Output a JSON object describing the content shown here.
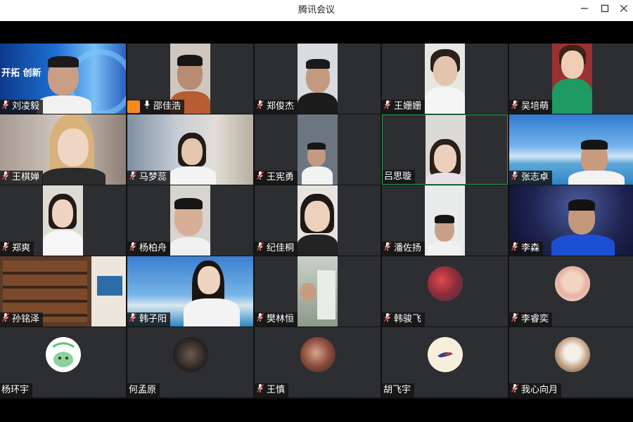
{
  "window": {
    "title": "腾讯会议",
    "min_icon": "minimize-icon",
    "max_icon": "maximize-icon",
    "close_icon": "close-icon"
  },
  "banner_text": "开拓 创新",
  "participants": [
    {
      "name": "刘凌毅",
      "mic": "muted"
    },
    {
      "name": "邵佳浩",
      "mic": "on"
    },
    {
      "name": "郑俊杰",
      "mic": "muted"
    },
    {
      "name": "王姗姗",
      "mic": "muted"
    },
    {
      "name": "吴培萌",
      "mic": "muted"
    },
    {
      "name": "王棋婵",
      "mic": "muted"
    },
    {
      "name": "马梦蕊",
      "mic": "muted"
    },
    {
      "name": "王宪勇",
      "mic": "muted"
    },
    {
      "name": "吕思璇",
      "mic": "none"
    },
    {
      "name": "张志卓",
      "mic": "muted"
    },
    {
      "name": "郑爽",
      "mic": "muted"
    },
    {
      "name": "杨柏舟",
      "mic": "muted"
    },
    {
      "name": "纪佳桐",
      "mic": "muted"
    },
    {
      "name": "潘佐扬",
      "mic": "muted"
    },
    {
      "name": "李森",
      "mic": "muted"
    },
    {
      "name": "孙铭泽",
      "mic": "muted"
    },
    {
      "name": "韩子阳",
      "mic": "muted"
    },
    {
      "name": "樊林恒",
      "mic": "muted"
    },
    {
      "name": "韩骏飞",
      "mic": "muted"
    },
    {
      "name": "李睿奕",
      "mic": "muted"
    },
    {
      "name": "杨环宇",
      "mic": "none"
    },
    {
      "name": "何孟原",
      "mic": "none"
    },
    {
      "name": "王慎",
      "mic": "muted"
    },
    {
      "name": "胡飞宇",
      "mic": "none"
    },
    {
      "name": "我心向月",
      "mic": "muted"
    }
  ]
}
